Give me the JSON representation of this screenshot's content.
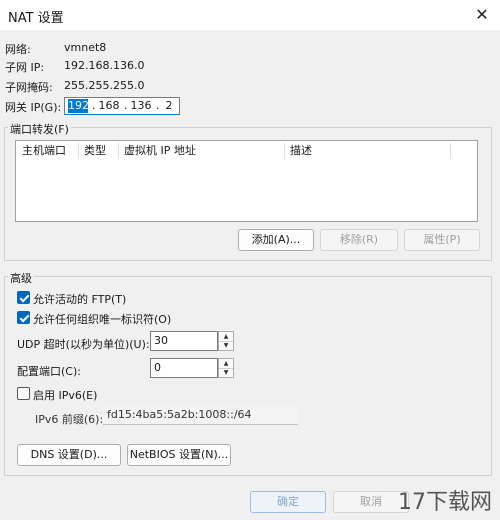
{
  "window": {
    "title": "NAT 设置",
    "close_glyph": "✕"
  },
  "info": {
    "network_label": "网络:",
    "network_value": "vmnet8",
    "subnet_ip_label": "子网 IP:",
    "subnet_ip_value": "192.168.136.0",
    "subnet_mask_label": "子网掩码:",
    "subnet_mask_value": "255.255.255.0",
    "gateway_label": "网关 IP(G):",
    "gateway_octets": [
      "192",
      "168",
      "136",
      "2"
    ]
  },
  "port_forwarding": {
    "group_label": "端口转发(F)",
    "columns": [
      "主机端口",
      "类型",
      "虚拟机 IP 地址",
      "描述"
    ],
    "rows": [],
    "add_label": "添加(A)...",
    "remove_label": "移除(R)",
    "properties_label": "属性(P)"
  },
  "advanced": {
    "group_label": "高级",
    "allow_ftp_label": "允许活动的 FTP(T)",
    "allow_ftp_checked": true,
    "allow_org_label": "允许任何组织唯一标识符(O)",
    "allow_org_checked": true,
    "udp_timeout_label": "UDP 超时(以秒为单位)(U):",
    "udp_timeout_value": "30",
    "config_port_label": "配置端口(C):",
    "config_port_value": "0",
    "enable_ipv6_label": "启用 IPv6(E)",
    "enable_ipv6_checked": false,
    "ipv6_prefix_label": "IPv6 前缀(6):",
    "ipv6_prefix_value": "fd15:4ba5:5a2b:1008::/64",
    "dns_label": "DNS 设置(D)...",
    "netbios_label": "NetBIOS 设置(N)..."
  },
  "footer": {
    "ok_label": "确定",
    "cancel_label": "取消"
  },
  "watermark": {
    "text": "17下载网"
  }
}
